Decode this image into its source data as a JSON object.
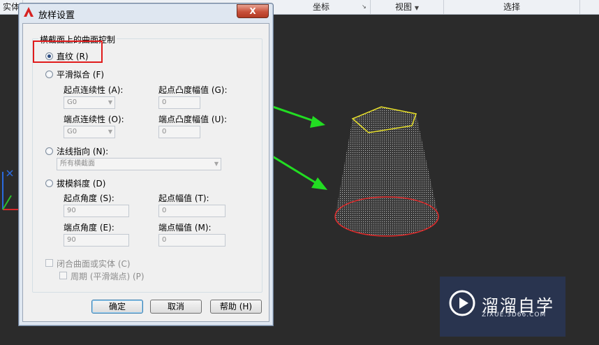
{
  "ribbon": {
    "sections": [
      {
        "label": "实体",
        "arrow": "↘"
      },
      {
        "label": "坐标",
        "arrow": "↘"
      },
      {
        "label": "视图",
        "arrow": "▼"
      },
      {
        "label": "选择",
        "arrow": ""
      }
    ]
  },
  "dialog": {
    "title": "放样设置",
    "close_label": "X",
    "group_title": "横截面上的曲面控制",
    "ruled_label": "直纹 (R)",
    "ruled_selected": true,
    "smooth_label": "平滑拟合 (F)",
    "start_continuity_label": "起点连续性 (A):",
    "start_continuity_value": "G0",
    "start_bulge_label": "起点凸度幅值 (G):",
    "start_bulge_value": "0",
    "end_continuity_label": "端点连续性 (O):",
    "end_continuity_value": "G0",
    "end_bulge_label": "端点凸度幅值 (U):",
    "end_bulge_value": "0",
    "normal_label": "法线指向 (N):",
    "normal_value": "所有横截面",
    "draft_label": "拔模斜度 (D)",
    "start_angle_label": "起点角度 (S):",
    "start_angle_value": "90",
    "start_magnitude_label": "起点幅值 (T):",
    "start_magnitude_value": "0",
    "end_angle_label": "端点角度 (E):",
    "end_angle_value": "90",
    "end_magnitude_label": "端点幅值 (M):",
    "end_magnitude_value": "0",
    "close_surface_label": "闭合曲面或实体 (C)",
    "periodic_label": "周期 (平滑端点) (P)",
    "ok_label": "确定",
    "cancel_label": "取消",
    "help_label": "帮助 (H)"
  },
  "watermark": {
    "title": "溜溜自学",
    "subtitle": "ZIXUE.3D66.COM"
  },
  "colors": {
    "annotation_red": "#e01b1b",
    "arrow_green": "#22dd22",
    "top_profile_yellow": "#e8e02a",
    "bottom_profile_red": "#e02a2a"
  }
}
